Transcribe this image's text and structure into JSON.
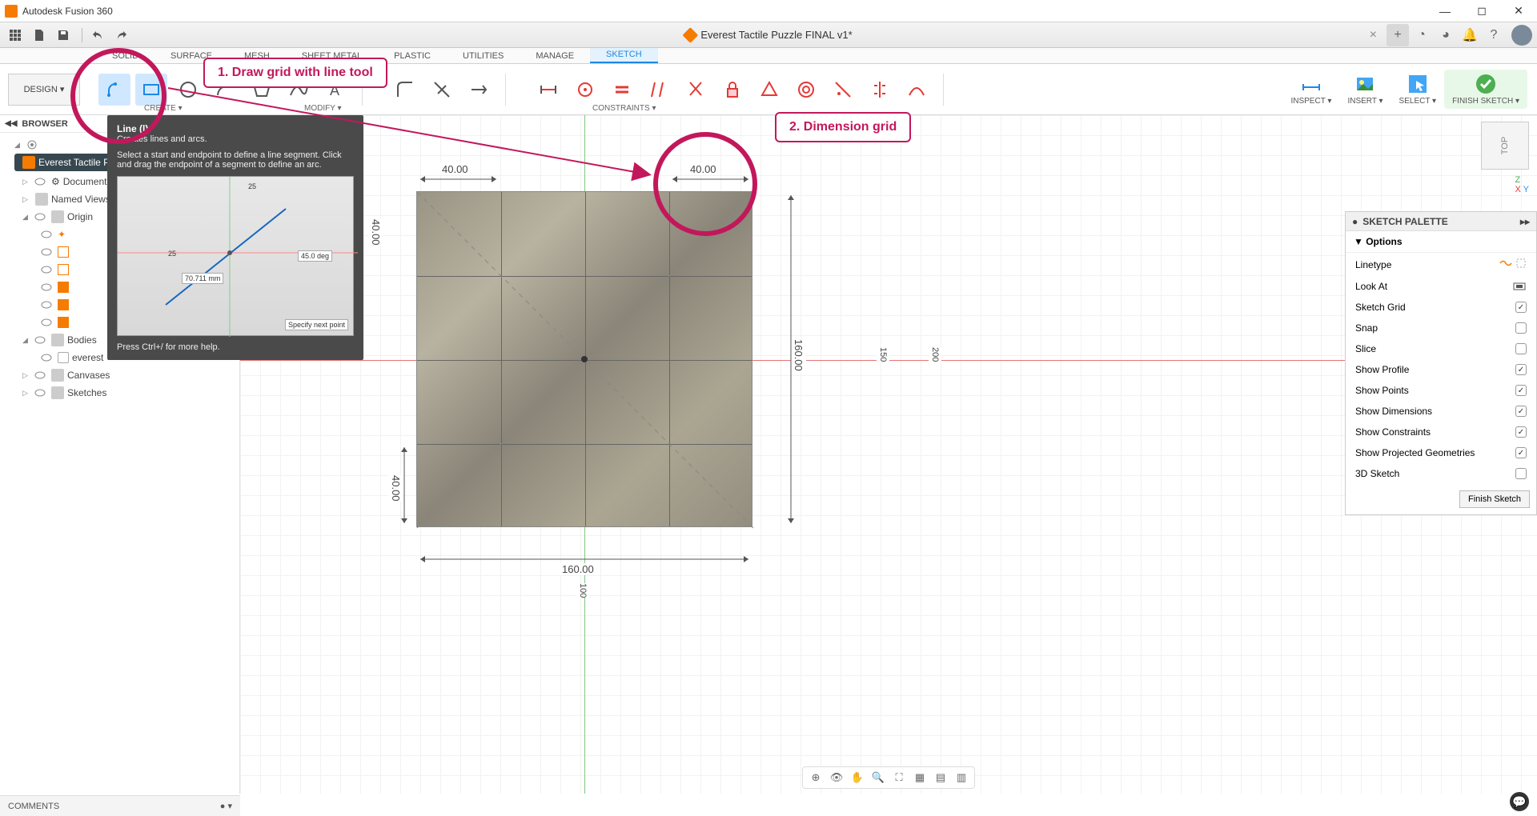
{
  "app_title": "Autodesk Fusion 360",
  "document": {
    "name": "Everest Tactile Puzzle FINAL v1*"
  },
  "quickbar": {
    "icons": [
      "grid",
      "file",
      "save",
      "undo",
      "redo"
    ]
  },
  "workspace_tabs": [
    "SOLID",
    "SURFACE",
    "MESH",
    "SHEET METAL",
    "PLASTIC",
    "UTILITIES",
    "MANAGE",
    "SKETCH"
  ],
  "active_ws_tab": "SKETCH",
  "design_btn": "DESIGN ▾",
  "ribbon_groups": {
    "create": "CREATE ▾",
    "modify": "MODIFY ▾",
    "constraints": "CONSTRAINTS ▾",
    "inspect": "INSPECT ▾",
    "insert": "INSERT ▾",
    "select": "SELECT ▾",
    "finish": "FINISH SKETCH ▾"
  },
  "browser": {
    "header": "BROWSER",
    "root": "Everest Tactile Puzzle FI…",
    "items": [
      {
        "label": "Document Settings",
        "icon": "gear"
      },
      {
        "label": "Named Views",
        "icon": "folder"
      },
      {
        "label": "Origin",
        "icon": "folder",
        "expanded": true
      },
      {
        "label": "Bodies",
        "icon": "folder",
        "expanded": true
      },
      {
        "label": "everest",
        "icon": "body",
        "indent": 2
      },
      {
        "label": "Canvases",
        "icon": "folder"
      },
      {
        "label": "Sketches",
        "icon": "folder"
      }
    ]
  },
  "tooltip": {
    "title": "Line (l)",
    "desc": "Creates lines and arcs.",
    "body": "Select a start and endpoint to define a line segment. Click and drag the endpoint of a segment to define an arc.",
    "img": {
      "len": "70.711 mm",
      "ang": "45.0 deg",
      "hint": "Specify next point",
      "x1": "25",
      "x2": "25"
    },
    "footer": "Press Ctrl+/ for more help."
  },
  "dimensions": {
    "top1": "40.00",
    "top2": "40.00",
    "left1": "40.00",
    "left2": "40.00",
    "bottom": "160.00",
    "right1": "160.00",
    "right2": "150",
    "right3": "200",
    "bottom2": "100"
  },
  "annotations": {
    "a1": "1. Draw grid with line tool",
    "a2": "2. Dimension grid"
  },
  "palette": {
    "title": "SKETCH PALETTE",
    "section": "▼ Options",
    "rows": [
      {
        "label": "Linetype",
        "type": "icons"
      },
      {
        "label": "Look At",
        "type": "lookat"
      },
      {
        "label": "Sketch Grid",
        "type": "chk",
        "on": true
      },
      {
        "label": "Snap",
        "type": "chk",
        "on": false
      },
      {
        "label": "Slice",
        "type": "chk",
        "on": false
      },
      {
        "label": "Show Profile",
        "type": "chk",
        "on": true
      },
      {
        "label": "Show Points",
        "type": "chk",
        "on": true
      },
      {
        "label": "Show Dimensions",
        "type": "chk",
        "on": true
      },
      {
        "label": "Show Constraints",
        "type": "chk",
        "on": true
      },
      {
        "label": "Show Projected Geometries",
        "type": "chk",
        "on": true
      },
      {
        "label": "3D Sketch",
        "type": "chk",
        "on": false
      }
    ],
    "finish": "Finish Sketch"
  },
  "comments": "COMMENTS",
  "viewcube": "TOP"
}
